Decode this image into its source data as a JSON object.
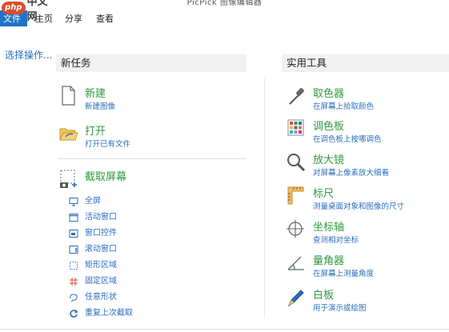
{
  "window": {
    "title": "PicPick 图像编辑器"
  },
  "watermark": {
    "logo": "php",
    "text": "中文网"
  },
  "menu": {
    "file": "文件",
    "home": "主页",
    "share": "分享",
    "view": "查看"
  },
  "nav": {
    "select_action": "选择操作..."
  },
  "new_task": {
    "header": "新任务",
    "new": {
      "title": "新建",
      "subtitle": "新建图像"
    },
    "open": {
      "title": "打开",
      "subtitle": "打开已有文件"
    },
    "capture": {
      "title": "截取屏幕",
      "items": [
        {
          "label": "全屏",
          "icon": "monitor-icon"
        },
        {
          "label": "活动窗口",
          "icon": "active-window-icon"
        },
        {
          "label": "窗口控件",
          "icon": "window-control-icon"
        },
        {
          "label": "滚动窗口",
          "icon": "scroll-window-icon"
        },
        {
          "label": "矩形区域",
          "icon": "rectangle-region-icon"
        },
        {
          "label": "固定区域",
          "icon": "fixed-region-icon"
        },
        {
          "label": "任意形状",
          "icon": "freeform-icon"
        },
        {
          "label": "重复上次截取",
          "icon": "repeat-icon"
        }
      ]
    }
  },
  "tools": {
    "header": "实用工具",
    "items": [
      {
        "title": "取色器",
        "subtitle": "在屏幕上拾取颜色",
        "icon": "eyedropper-icon"
      },
      {
        "title": "调色板",
        "subtitle": "在调色板上按哪调色",
        "icon": "palette-icon"
      },
      {
        "title": "放大镜",
        "subtitle": "对屏幕上像素放大细看",
        "icon": "magnifier-icon"
      },
      {
        "title": "标尺",
        "subtitle": "测量桌面对象和图像的尺寸",
        "icon": "ruler-icon"
      },
      {
        "title": "坐标轴",
        "subtitle": "查测相对坐标",
        "icon": "crosshair-icon"
      },
      {
        "title": "量角器",
        "subtitle": "在屏幕上测量角度",
        "icon": "protractor-icon"
      },
      {
        "title": "白板",
        "subtitle": "用于演示或绘图",
        "icon": "whiteboard-pen-icon"
      }
    ]
  },
  "colors": {
    "accent": "#1f73c8",
    "title_green": "#2e9a3e",
    "link_blue": "#2a6ebd",
    "header_bg": "#f1f1f1"
  }
}
